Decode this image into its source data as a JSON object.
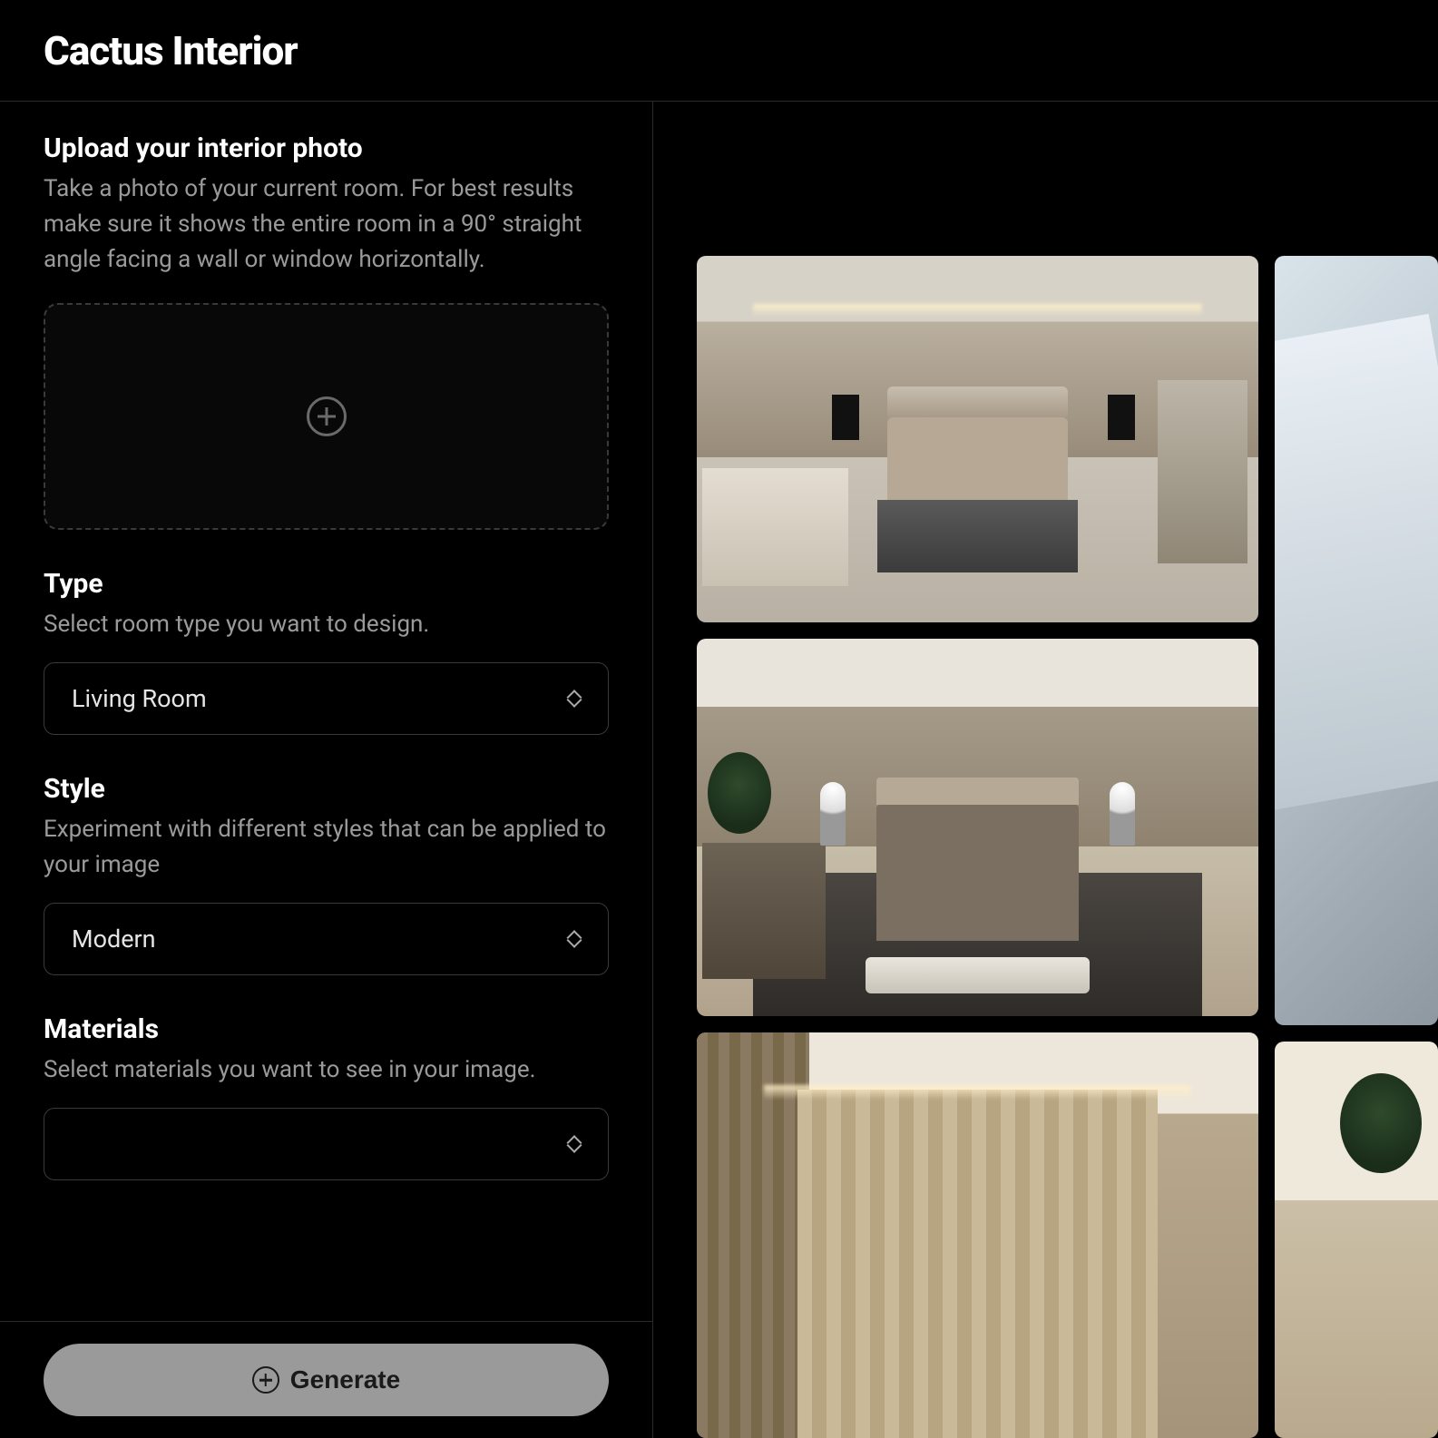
{
  "brand": "Cactus Interior",
  "upload": {
    "title": "Upload your interior photo",
    "desc": "Take a photo of your current room. For best results make sure it shows the entire room in a 90° straight angle facing a wall or window horizontally."
  },
  "type": {
    "title": "Type",
    "desc": "Select room type you want to design.",
    "value": "Living Room"
  },
  "style": {
    "title": "Style",
    "desc": "Experiment with different styles that can be applied to your image",
    "value": "Modern"
  },
  "materials": {
    "title": "Materials",
    "desc": "Select materials you want to see in your image.",
    "value": ""
  },
  "generate_label": "Generate"
}
